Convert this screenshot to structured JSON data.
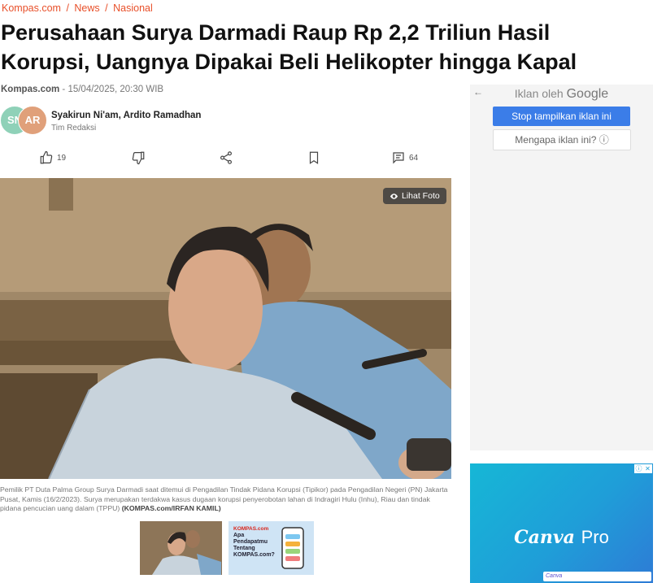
{
  "breadcrumb": {
    "site": "Kompas.com",
    "section": "News",
    "sub": "Nasional",
    "sep": "/"
  },
  "article": {
    "title": "Perusahaan Surya Darmadi Raup Rp 2,2 Triliun Hasil Korupsi, Uangnya Dipakai Beli Helikopter hingga Kapal",
    "source": "Kompas.com",
    "datetime": " - 15/04/2025, 20:30 WIB",
    "authors": "Syakirun Ni'am,  Ardito Ramadhan",
    "team": "Tim Redaksi",
    "avatar1": "SN",
    "avatar2": "AR"
  },
  "actions": {
    "like_count": "19",
    "comment_count": "64"
  },
  "photo": {
    "view_label": "Lihat Foto",
    "caption": "Pemilik PT Duta Palma Group Surya Darmadi saat ditemui di Pengadilan Tindak Pidana Korupsi (Tipikor) pada Pengadilan Negeri (PN) Jakarta Pusat, Kamis (16/2/2023). Surya merupakan terdakwa kasus dugaan korupsi penyerobotan lahan di Indragiri Hulu (Inhu), Riau dan tindak pidana pencucian uang dalam (TPPU)",
    "credit": "(KOMPAS.com/IRFAN KAMIL)"
  },
  "thumb_promo": {
    "brand": "KOMPAS.com",
    "line1": "Apa Pendapatmu",
    "line2": "Tentang",
    "line3": "KOMPAS.com?"
  },
  "ad": {
    "back": "←",
    "by_prefix": "Iklan oleh",
    "by_brand": "Google",
    "stop_label": "Stop tampilkan iklan ini",
    "why_label": "Mengapa iklan ini? ⓘ"
  },
  "ad2": {
    "brand": "Canva",
    "product": "Pro",
    "footer_brand": "Canva"
  }
}
